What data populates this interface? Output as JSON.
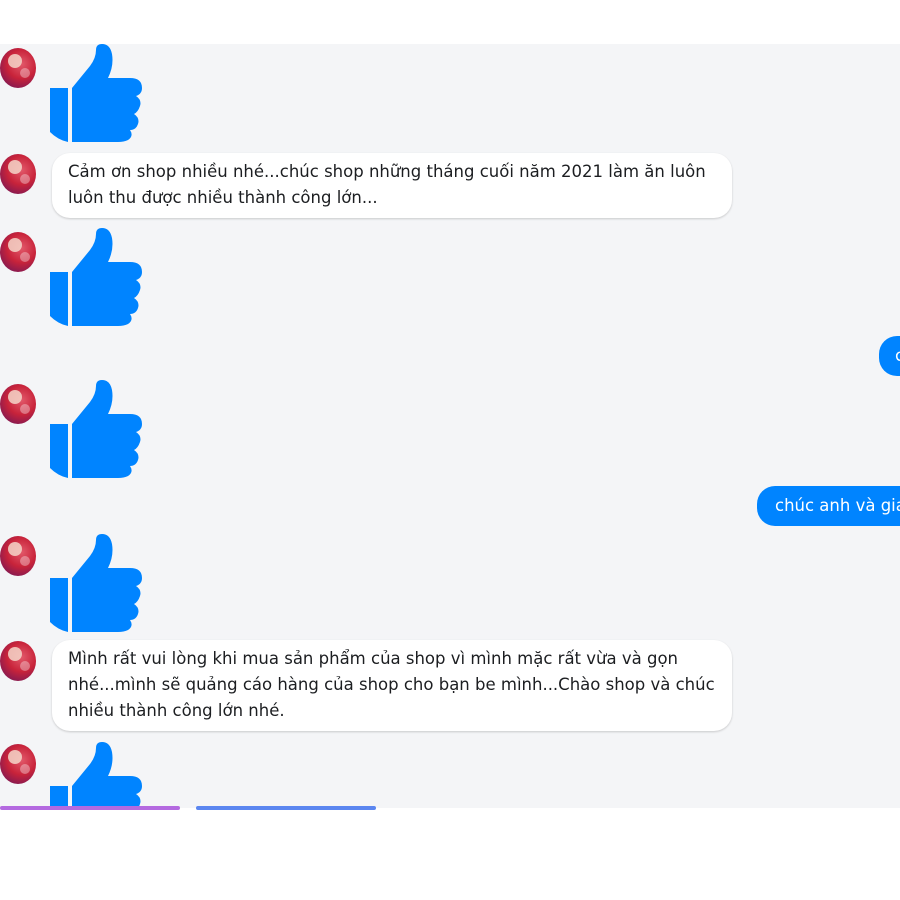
{
  "conversation": {
    "messages": [
      {
        "sender": "customer",
        "type": "like-sticker",
        "icon": "thumbs-up-icon"
      },
      {
        "sender": "customer",
        "type": "text",
        "text": "Cảm ơn shop nhiều nhé...chúc shop những tháng cuối năm 2021 làm ăn luôn luôn thu được nhiều thành công lớn..."
      },
      {
        "sender": "customer",
        "type": "like-sticker",
        "icon": "thumbs-up-icon"
      },
      {
        "sender": "shop",
        "type": "text",
        "text": "c"
      },
      {
        "sender": "customer",
        "type": "like-sticker",
        "icon": "thumbs-up-icon"
      },
      {
        "sender": "shop",
        "type": "text",
        "text": "chúc anh và gia"
      },
      {
        "sender": "customer",
        "type": "like-sticker",
        "icon": "thumbs-up-icon"
      },
      {
        "sender": "customer",
        "type": "text",
        "text": "Mình rất vui lòng khi mua sản phẩm của shop vì mình mặc rất vừa và gọn nhé...mình sẽ quảng cáo hàng của shop cho bạn be mình...Chào shop và chúc nhiều thành công lớn nhé."
      },
      {
        "sender": "customer",
        "type": "like-sticker",
        "icon": "thumbs-up-icon"
      }
    ]
  },
  "colors": {
    "chat_background": "#f4f5f7",
    "like_blue": "#0084ff",
    "outgoing_bubble": "#0084ff",
    "incoming_bubble": "#ffffff"
  }
}
